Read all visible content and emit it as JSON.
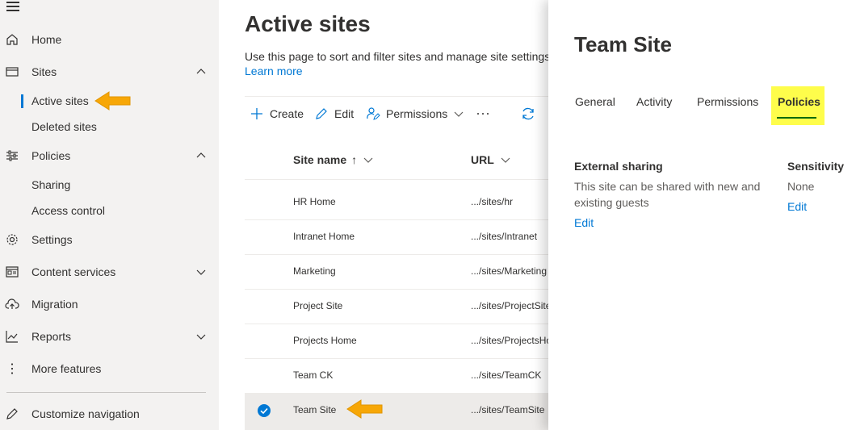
{
  "nav": {
    "items": [
      {
        "label": "Home"
      },
      {
        "label": "Sites"
      },
      {
        "label": "Active sites"
      },
      {
        "label": "Deleted sites"
      },
      {
        "label": "Policies"
      },
      {
        "label": "Sharing"
      },
      {
        "label": "Access control"
      },
      {
        "label": "Settings"
      },
      {
        "label": "Content services"
      },
      {
        "label": "Migration"
      },
      {
        "label": "Reports"
      },
      {
        "label": "More features"
      },
      {
        "label": "Customize navigation"
      }
    ]
  },
  "main": {
    "title": "Active sites",
    "description": "Use this page to sort and filter sites and manage site settings",
    "learn_more": "Learn more",
    "commands": {
      "create": "Create",
      "edit": "Edit",
      "permissions": "Permissions"
    },
    "columns": {
      "site_name": "Site name",
      "site_name_sort": "↑",
      "url": "URL"
    },
    "rows": [
      {
        "name": "HR Home",
        "url": ".../sites/hr"
      },
      {
        "name": "Intranet Home",
        "url": ".../sites/Intranet"
      },
      {
        "name": "Marketing",
        "url": ".../sites/Marketing"
      },
      {
        "name": "Project Site",
        "url": ".../sites/ProjectSite"
      },
      {
        "name": "Projects Home",
        "url": ".../sites/ProjectsHo"
      },
      {
        "name": "Team CK",
        "url": ".../sites/TeamCK"
      },
      {
        "name": "Team Site",
        "url": ".../sites/TeamSite"
      }
    ]
  },
  "panel": {
    "title": "Team Site",
    "tabs": {
      "general": "General",
      "activity": "Activity",
      "permissions": "Permissions",
      "policies": "Policies"
    },
    "external_sharing": {
      "heading": "External sharing",
      "text": "This site can be shared with new and existing guests",
      "edit": "Edit"
    },
    "sensitivity": {
      "heading": "Sensitivity",
      "value": "None",
      "edit": "Edit"
    }
  },
  "colors": {
    "accent": "#0078d4",
    "arrow": "#f7a707",
    "highlight": "#fefd4b",
    "tab_underline": "#0b6a0b",
    "nav_bg": "#f3f2f1"
  }
}
